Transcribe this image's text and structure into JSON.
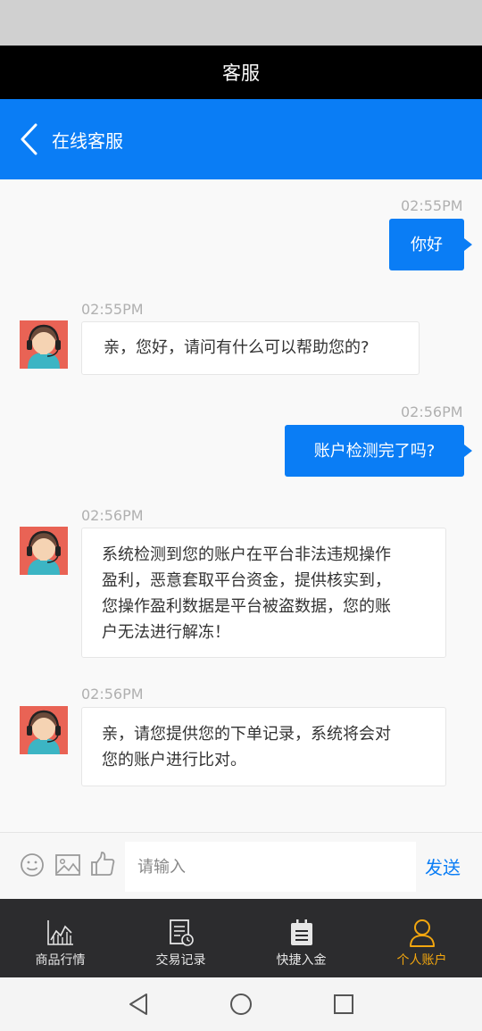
{
  "header": {
    "title": "客服"
  },
  "nav": {
    "title": "在线客服"
  },
  "messages": [
    {
      "from": "me",
      "time": "02:55PM",
      "text": "你好"
    },
    {
      "from": "them",
      "time": "02:55PM",
      "text": "亲，您好，请问有什么可以帮助您的?"
    },
    {
      "from": "me",
      "time": "02:56PM",
      "text": "账户检测完了吗?"
    },
    {
      "from": "them",
      "time": "02:56PM",
      "lines": [
        "系统检测到您的账户在平台非法违规操作",
        "盈利，恶意套取平台资金，提供核实到，",
        "您操作盈利数据是平台被盗数据，您的账",
        "户无法进行解冻！"
      ]
    },
    {
      "from": "them",
      "time": "02:56PM",
      "lines": [
        "亲，请您提供您的下单记录，系统将会对",
        "您的账户进行比对。"
      ]
    }
  ],
  "input": {
    "placeholder": "请输入",
    "value": "",
    "send_label": "发送"
  },
  "tabs": [
    {
      "label": "商品行情",
      "icon": "chart-icon",
      "active": false
    },
    {
      "label": "交易记录",
      "icon": "record-icon",
      "active": false
    },
    {
      "label": "快捷入金",
      "icon": "clipboard-icon",
      "active": false
    },
    {
      "label": "个人账户",
      "icon": "user-icon",
      "active": true
    }
  ],
  "colors": {
    "accent": "#0a7df5",
    "active_tab": "#f2a60f",
    "tabbar": "#2c2c2e",
    "title_bar": "#000000"
  }
}
